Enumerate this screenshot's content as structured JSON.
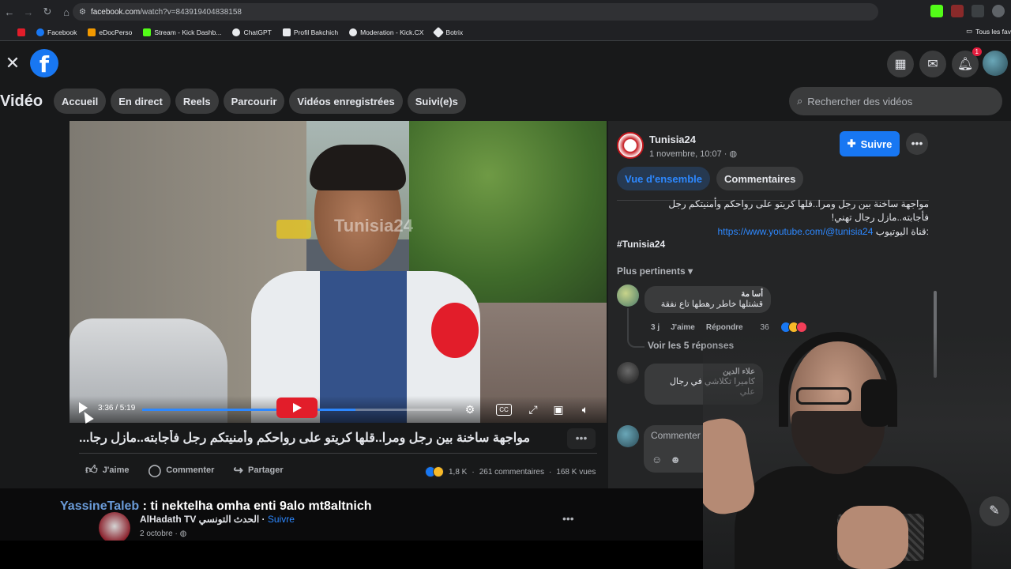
{
  "browser": {
    "url_domain": "facebook.com",
    "url_path": "/watch?v=843919404838158",
    "bookmarks": [
      {
        "label": "Facebook",
        "color": "#1877f2"
      },
      {
        "label": "eDocPerso",
        "color": "#f29900"
      },
      {
        "label": "Stream - Kick Dashb...",
        "color": "#53fc18"
      },
      {
        "label": "ChatGPT",
        "color": "#e8eaed"
      },
      {
        "label": "Profil Bakchich",
        "color": "#e8eaed"
      },
      {
        "label": "Moderation - Kick.CX",
        "color": "#e8eaed"
      },
      {
        "label": "Botrix",
        "color": "#e8eaed"
      }
    ],
    "all_bookmarks": "Tous les fav"
  },
  "header": {
    "notif_count": "1"
  },
  "video_nav": {
    "title": "Vidéo",
    "tabs": [
      "Accueil",
      "En direct",
      "Reels",
      "Parcourir",
      "Vidéos enregistrées",
      "Suivi(e)s"
    ],
    "search_placeholder": "Rechercher des vidéos"
  },
  "player": {
    "watermark": "Tunisia24",
    "time": "3:36 / 5:19",
    "progress": 0.69,
    "cc_label": "CC"
  },
  "video": {
    "title": "مواجهة ساخنة بين رجل ومرا..قلها كريتو على رواحكم وأمنيتكم رجل فأجابته..مازل رجا...",
    "like": "J'aime",
    "comment": "Commenter",
    "share": "Partager",
    "reactions": "1,8 K",
    "comments": "261 commentaires",
    "views": "168 K vues"
  },
  "caption": {
    "name": "YassineTaleb",
    "text": " : ti nektelha omha enti 9alo mt8altnich"
  },
  "next_post": {
    "page": "AlHadath TV الحدث التونسي",
    "follow": "Suivre",
    "date": "2 octobre · "
  },
  "sidebar": {
    "page_name": "Tunisia24",
    "date": "1 novembre, 10:07 · ",
    "follow_label": "Suivre",
    "tabs": [
      "Vue d'ensemble",
      "Commentaires"
    ],
    "description_line1": "مواجهة ساخنة بين رجل ومرا..قلها كريتو على رواحكم وأمنيتكم رجل",
    "description_line2": "فأجابته..مازل رجال تهني!",
    "yt_label": "قناة اليوتيوب:",
    "yt_link": "https://www.youtube.com/@tunisia24",
    "hashtag": "#Tunisia24",
    "sort_label": "Plus pertinents",
    "comments": [
      {
        "author": "أسا مة",
        "text": "قشتلها خاطر رهطها تاع نفقة",
        "time": "3 j",
        "like": "J'aime",
        "reply": "Répondre",
        "count": "36"
      },
      {
        "author": "علاء الدين",
        "text": "كاميرا تكلاشي في رجال علي"
      }
    ],
    "replies_label": "Voir les 5 réponses",
    "comment_placeholder": "Commenter en tant"
  },
  "colors": {
    "accent": "#1877f2",
    "link": "#2d88ff",
    "bg": "#18191a",
    "panel": "#242526"
  }
}
